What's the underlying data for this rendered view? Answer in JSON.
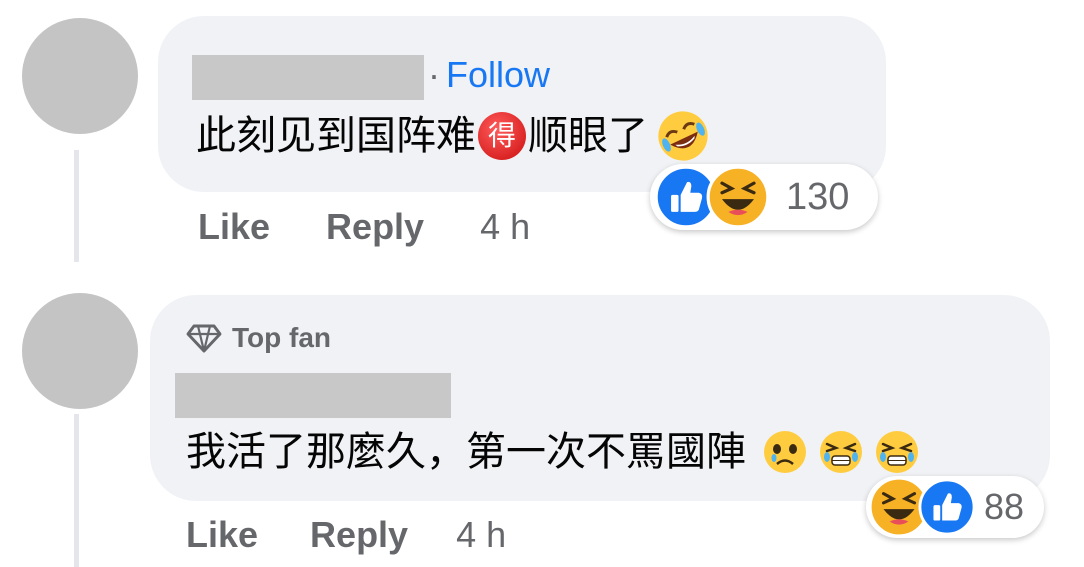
{
  "comments": [
    {
      "follow_separator": "·",
      "follow_label": "Follow",
      "text_before": "此刻见到国阵难",
      "inline_emoji": "得",
      "text_after": "顺眼了",
      "reaction_count": "130",
      "actions": {
        "like": "Like",
        "reply": "Reply",
        "time": "4 h"
      }
    },
    {
      "badge_label": "Top fan",
      "text": "我活了那麼久，第一次不罵國陣",
      "reaction_count": "88",
      "actions": {
        "like": "Like",
        "reply": "Reply",
        "time": "4 h"
      }
    }
  ],
  "colors": {
    "bubble": "#f0f2f5",
    "link": "#1877f2",
    "secondary_text": "#65676b",
    "like_blue": "#1877f2",
    "haha_yellow": "#f7b125"
  },
  "icons": [
    "diamond-icon",
    "like-reaction-icon",
    "haha-reaction-icon",
    "rolling-laughing-emoji",
    "sad-emoji",
    "tears-emoji"
  ]
}
